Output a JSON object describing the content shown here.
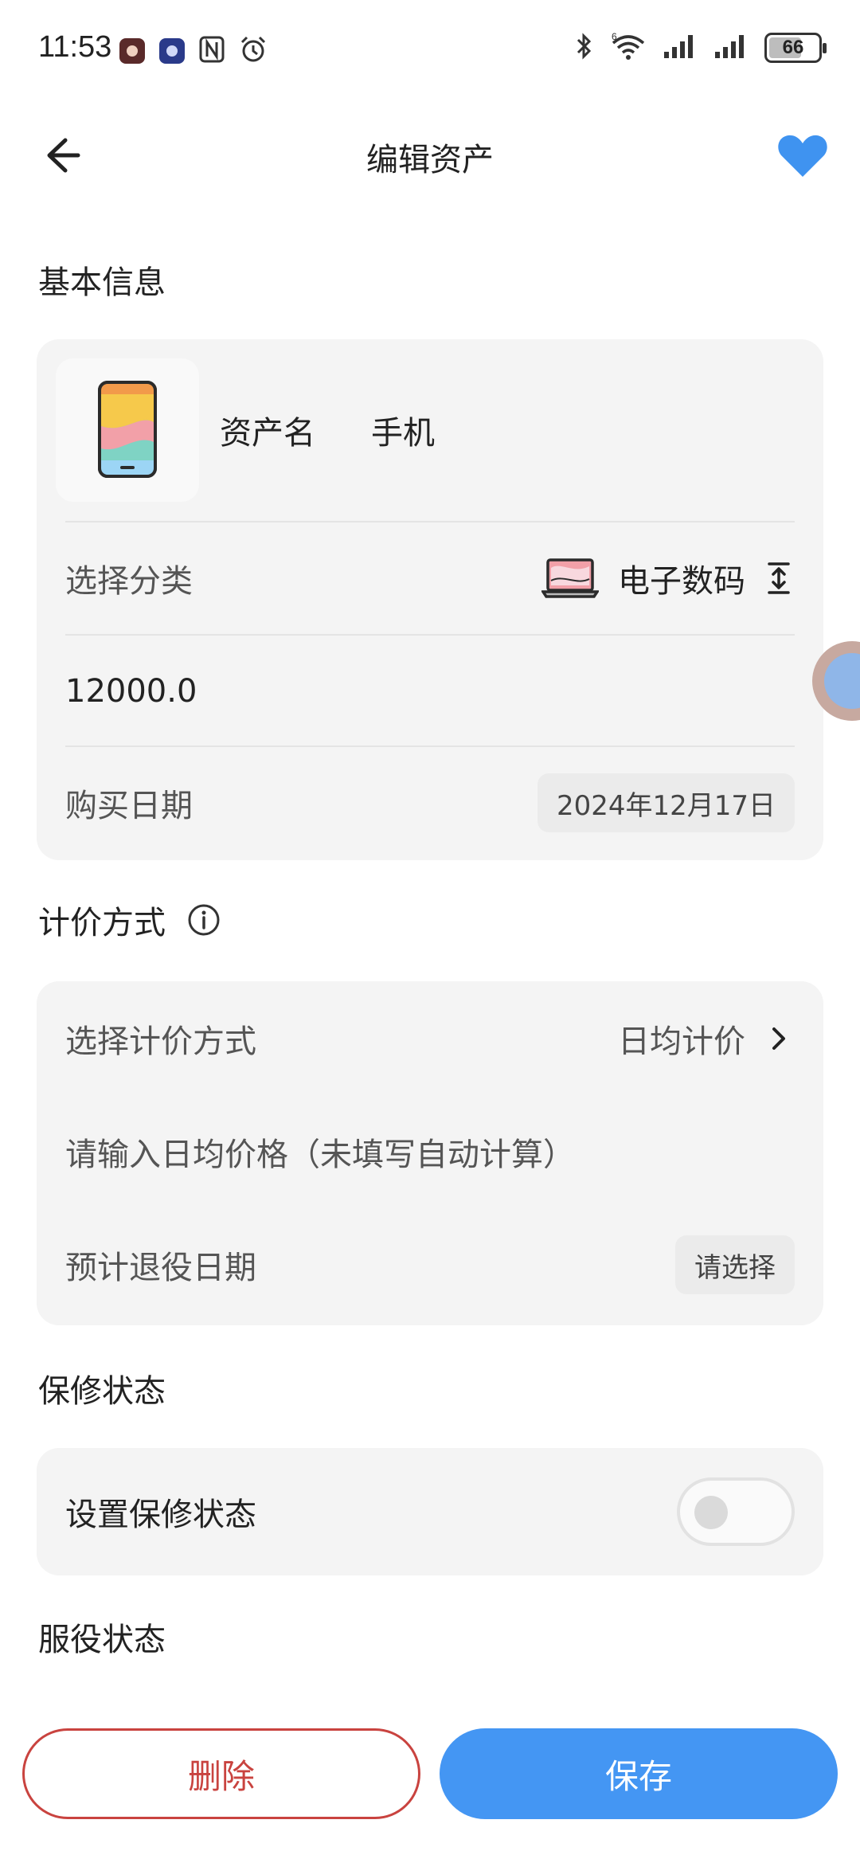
{
  "status_bar": {
    "time": "11:53",
    "battery": "66",
    "signal_5g_label": "6"
  },
  "header": {
    "title": "编辑资产",
    "back_icon": "arrow-left-icon",
    "favorite_icon": "heart-icon",
    "favorite_color": "#3f93f0"
  },
  "basic_info": {
    "section_title": "基本信息",
    "asset_name_label": "资产名",
    "asset_name_value": "手机",
    "category_label": "选择分类",
    "category_value": "电子数码",
    "price_value": "12000.0",
    "purchase_date_label": "购买日期",
    "purchase_date_value": "2024年12月17日"
  },
  "pricing": {
    "section_title": "计价方式",
    "method_label": "选择计价方式",
    "method_value": "日均计价",
    "daily_price_placeholder": "请输入日均价格（未填写自动计算）",
    "retire_date_label": "预计退役日期",
    "retire_date_value": "请选择"
  },
  "warranty": {
    "section_title": "保修状态",
    "toggle_label": "设置保修状态",
    "toggle_on": false
  },
  "service": {
    "section_title": "服役状态"
  },
  "actions": {
    "delete_label": "删除",
    "save_label": "保存",
    "delete_color": "#c9433f",
    "save_color": "#4496f3"
  }
}
